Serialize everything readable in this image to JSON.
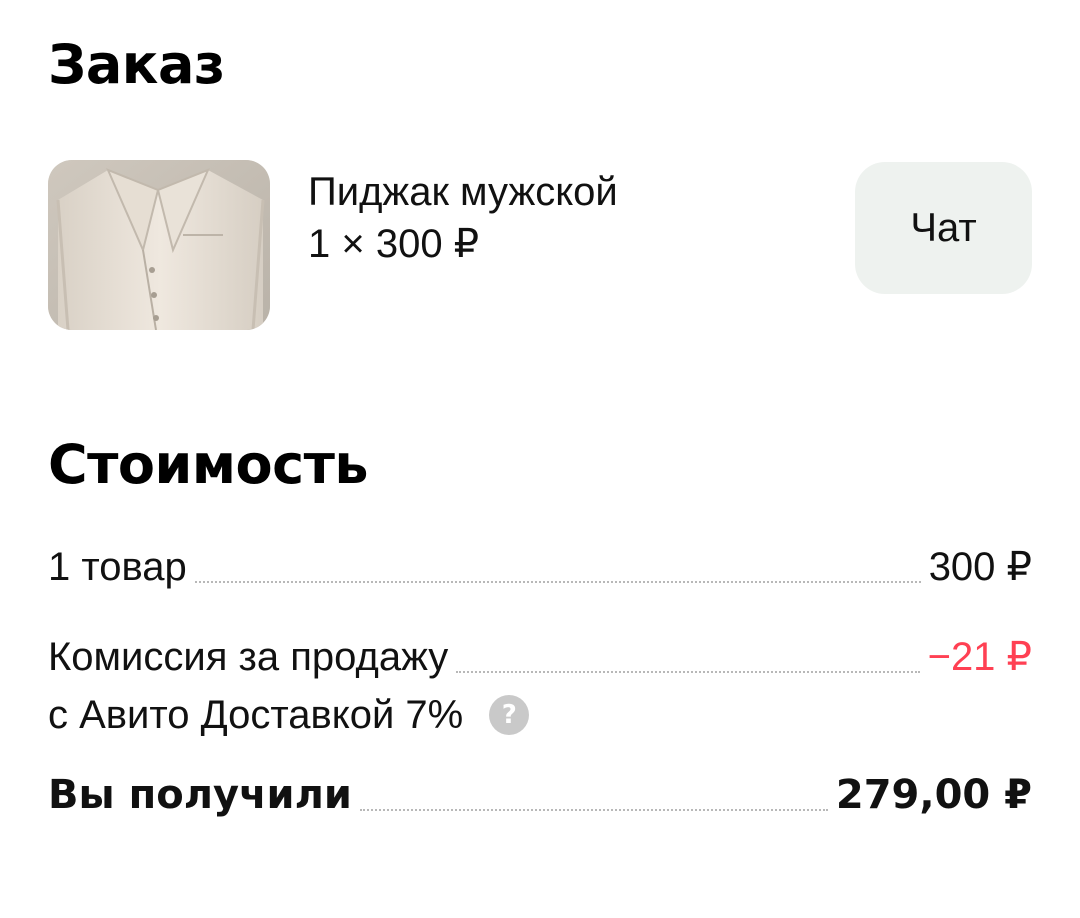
{
  "order": {
    "title": "Заказ",
    "item": {
      "image": "men-jacket-photo",
      "name": "Пиджак мужской",
      "quantity_price": "1 × 300 ₽"
    },
    "chat_label": "Чат"
  },
  "cost": {
    "title": "Стоимость",
    "items_label": "1 товар",
    "items_value": "300 ₽",
    "commission_label_line1": "Комиссия за продажу",
    "commission_label_line2": "с Авито Доставкой 7%",
    "commission_value": "−21 ₽",
    "help_icon": "?",
    "total_label": "Вы получили",
    "total_value": "279,00 ₽"
  },
  "colors": {
    "negative": "#ff4053",
    "chat_button_bg": "#eef2ef",
    "help_icon_bg": "#c9c9c9",
    "dots": "#b8b8b8"
  }
}
